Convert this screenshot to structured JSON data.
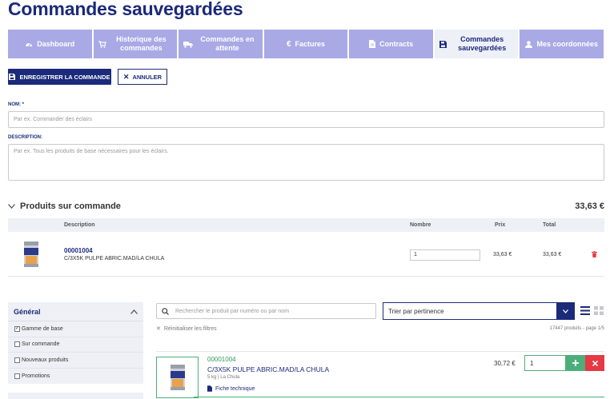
{
  "page": {
    "title": "Commandes sauvegardées"
  },
  "tabs": [
    {
      "label": "Dashboard",
      "icon": "dashboard-icon"
    },
    {
      "label": "Historique des commandes",
      "icon": "cart-icon"
    },
    {
      "label": "Commandes en attente",
      "icon": "truck-icon"
    },
    {
      "label": "Factures",
      "icon": "euro-icon"
    },
    {
      "label": "Contracts",
      "icon": "document-icon"
    },
    {
      "label": "Commandes sauvegardées",
      "icon": "save-icon",
      "active": true
    },
    {
      "label": "Mes coordonnées",
      "icon": "user-icon"
    }
  ],
  "actions": {
    "save_label": "ENREGISTRER LA COMMANDE",
    "cancel_label": "ANNULER"
  },
  "form": {
    "name_label": "NOM: *",
    "name_placeholder": "Par ex. Commander des éclairs",
    "description_label": "DESCRIPTION:",
    "description_placeholder": "Par ex. Tous les produits de base nécessaires pour les éclairs."
  },
  "order": {
    "title": "Produits sur commande",
    "total": "33,63 €",
    "columns": {
      "description": "Description",
      "quantity": "Nombre",
      "price": "Prix",
      "total": "Total"
    },
    "rows": [
      {
        "code": "00001004",
        "name": "C/3X5K PULPE ABRIC.MAD/LA CHULA",
        "quantity": "1",
        "price": "33,63 €",
        "total": "33,63 €"
      }
    ]
  },
  "filters": {
    "title": "Général",
    "items": [
      {
        "label": "Gamme de base",
        "checked": true
      },
      {
        "label": "Sur commande",
        "checked": false
      },
      {
        "label": "Nouveaux produits",
        "checked": false
      },
      {
        "label": "Promotions",
        "checked": false
      }
    ]
  },
  "catalog": {
    "search_placeholder": "Rechercher le produit par numéro ou par nom",
    "sort_selected": "Trier par pertinence",
    "reset_label": "Réinitialiser les filtres",
    "count_text": "17447 produits - page 1/5",
    "products": [
      {
        "code": "00001004",
        "name": "C/3X5K PULPE ABRIC.MAD/LA CHULA",
        "meta": "5 kg | La Chula",
        "sheet_label": "Fiche technique",
        "price": "30,72 €",
        "quantity": "1"
      }
    ]
  },
  "colors": {
    "brand": "#1b2a7a",
    "tab": "#a9a9e6",
    "add": "#4cae7a",
    "delete": "#e53946"
  }
}
